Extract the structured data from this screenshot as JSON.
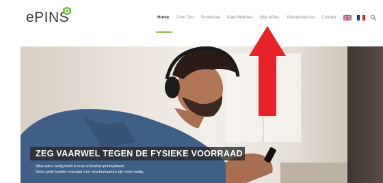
{
  "header": {
    "logo_text": "ePINS",
    "nav": [
      "Home",
      "Over Ons",
      "Producten",
      "Klant Worden",
      "Mijn ePins",
      "Klantenservice",
      "Contact"
    ],
    "active_nav": "Home",
    "flags": [
      "uk-flag-icon",
      "nl-flag-icon"
    ],
    "search_icon": "search-icon",
    "accent_color": "#7cc242"
  },
  "hero": {
    "headline": "ZEG VAARWEL TEGEN DE FYSIEKE VOORRAAD",
    "subline_1": "Alles wat u nodig heeft is onze eVoucher-printsysteem.",
    "subline_2": "Geen grote fysieke voorraad voor voucherkaarten zijn meer nodig."
  },
  "annotation": {
    "arrow_color": "#e8232a",
    "arrow_target": "Mijn ePins"
  }
}
